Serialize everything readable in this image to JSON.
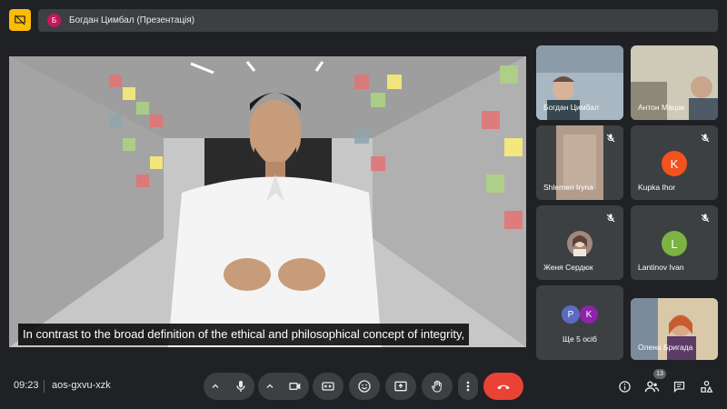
{
  "header": {
    "presenter_initial": "Б",
    "title": "Богдан Цимбал (Презентація)"
  },
  "stage": {
    "caption": "In contrast to the broad definition of the ethical and philosophical concept of integrity,"
  },
  "participants": [
    {
      "name": "Богдан Цимбал",
      "type": "video"
    },
    {
      "name": "Антон Мацак",
      "type": "video"
    },
    {
      "name": "Shlemen Iryna",
      "type": "video-muted"
    },
    {
      "name": "Kupka Ihor",
      "type": "avatar",
      "initial": "K",
      "color": "#f4511e"
    },
    {
      "name": "Женя Сердюк",
      "type": "photo"
    },
    {
      "name": "Lantinov Ivan",
      "type": "avatar",
      "initial": "L",
      "color": "#7cb342"
    },
    {
      "name": "Ще 5 осіб",
      "type": "more",
      "initials": [
        "P",
        "K"
      ],
      "colors": [
        "#5c6bc0",
        "#8e24aa"
      ]
    },
    {
      "name": "Олена Бригада",
      "type": "video"
    }
  ],
  "footer": {
    "time": "09:23",
    "meeting_code": "aos-gxvu-xzk",
    "people_count": "13"
  },
  "colors": {
    "end_call": "#ea4335",
    "logo": "#fbbc04",
    "background": "#202124"
  }
}
